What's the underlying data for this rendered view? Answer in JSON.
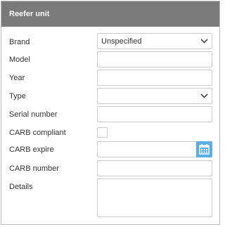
{
  "panel": {
    "title": "Reefer unit"
  },
  "form": {
    "brand": {
      "label": "Brand",
      "value": "Unspecified"
    },
    "model": {
      "label": "Model",
      "value": ""
    },
    "year": {
      "label": "Year",
      "value": ""
    },
    "type": {
      "label": "Type",
      "value": ""
    },
    "serial_number": {
      "label": "Serial number",
      "value": ""
    },
    "carb_compliant": {
      "label": "CARB compliant",
      "checked": false
    },
    "carb_expire": {
      "label": "CARB expire",
      "value": ""
    },
    "carb_number": {
      "label": "CARB number",
      "value": ""
    },
    "details": {
      "label": "Details",
      "value": ""
    }
  },
  "icons": {
    "dropdown": "chevron-down-icon",
    "calendar": "calendar-icon"
  },
  "colors": {
    "header_bg": "#7a7a7a",
    "calendar_button": "#5aaee6",
    "border": "#cccccc"
  }
}
